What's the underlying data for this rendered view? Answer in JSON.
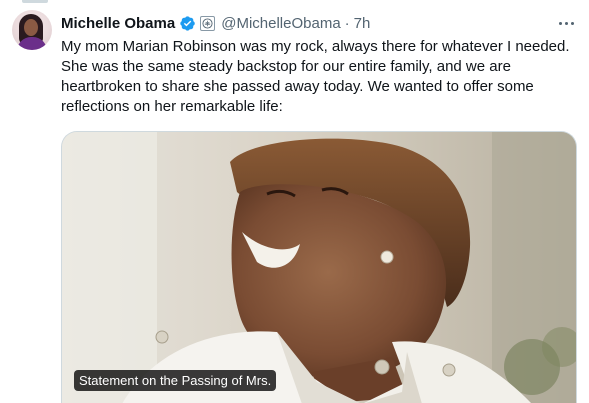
{
  "tweet": {
    "author_name": "Michelle Obama",
    "handle": "@MichelleObama",
    "separator": "·",
    "time": "7h",
    "text": "My mom Marian Robinson was my rock, always there for whatever I needed. She was the same steady backstop for our entire family, and we are heartbroken to share she passed away today. We wanted to offer some reflections on her remarkable life:",
    "media_caption": "Statement on the Passing of Mrs."
  },
  "icons": {
    "verified": "verified-badge-icon",
    "affiliation": "government-seal-icon",
    "more": "more-options-icon"
  },
  "colors": {
    "text_primary": "#0f1419",
    "text_secondary": "#536471",
    "verified_blue": "#1d9bf0",
    "border": "#cfd9de"
  }
}
